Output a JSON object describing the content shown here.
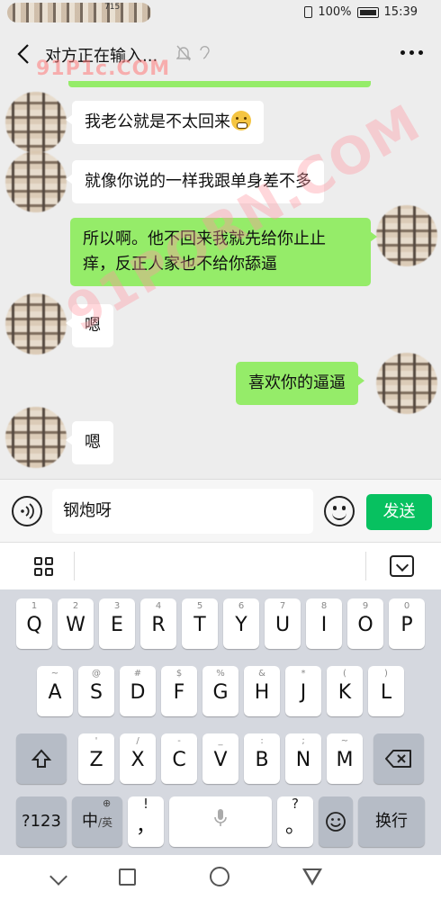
{
  "status": {
    "time": "15:39",
    "battery": "100%",
    "carrier_fragment": "715"
  },
  "header": {
    "title": "对方正在输入...",
    "watermark": "91P1c.COM"
  },
  "chat": {
    "watermark": "91PORN.COM",
    "messages": [
      {
        "side": "in",
        "text": "我老公就是不太回来"
      },
      {
        "side": "in",
        "text": "就像你说的一样我跟单身差不多"
      },
      {
        "side": "out",
        "line1": "所以啊。他不回来我就先给你止止",
        "line2": "痒，反正人家也不给你舔逼"
      },
      {
        "side": "in",
        "text": "嗯"
      },
      {
        "side": "out",
        "text": "喜欢你的逼逼"
      },
      {
        "side": "in",
        "text": "嗯"
      }
    ]
  },
  "input": {
    "value": "钢炮呀",
    "send_label": "发送"
  },
  "keyboard": {
    "row1": [
      {
        "main": "Q",
        "sub": "1"
      },
      {
        "main": "W",
        "sub": "2"
      },
      {
        "main": "E",
        "sub": "3"
      },
      {
        "main": "R",
        "sub": "4"
      },
      {
        "main": "T",
        "sub": "5"
      },
      {
        "main": "Y",
        "sub": "6"
      },
      {
        "main": "U",
        "sub": "7"
      },
      {
        "main": "I",
        "sub": "8"
      },
      {
        "main": "O",
        "sub": "9"
      },
      {
        "main": "P",
        "sub": "0"
      }
    ],
    "row2": [
      {
        "main": "A",
        "sub": "~"
      },
      {
        "main": "S",
        "sub": "@"
      },
      {
        "main": "D",
        "sub": "#"
      },
      {
        "main": "F",
        "sub": "$"
      },
      {
        "main": "G",
        "sub": "%"
      },
      {
        "main": "H",
        "sub": "&"
      },
      {
        "main": "J",
        "sub": "*"
      },
      {
        "main": "K",
        "sub": "("
      },
      {
        "main": "L",
        "sub": ")"
      }
    ],
    "row3": [
      {
        "main": "Z",
        "sub": "'"
      },
      {
        "main": "X",
        "sub": "/"
      },
      {
        "main": "C",
        "sub": "-"
      },
      {
        "main": "V",
        "sub": "_"
      },
      {
        "main": "B",
        "sub": ":"
      },
      {
        "main": "N",
        "sub": ";"
      },
      {
        "main": "M",
        "sub": "~"
      }
    ],
    "symbols_label": "?123",
    "lang_main": "中",
    "lang_sub": "/英",
    "lang_globe": "⊕",
    "comma_main": "，",
    "comma_sub": "!",
    "period_main": "。",
    "period_sub": "?",
    "enter_label": "换行"
  }
}
